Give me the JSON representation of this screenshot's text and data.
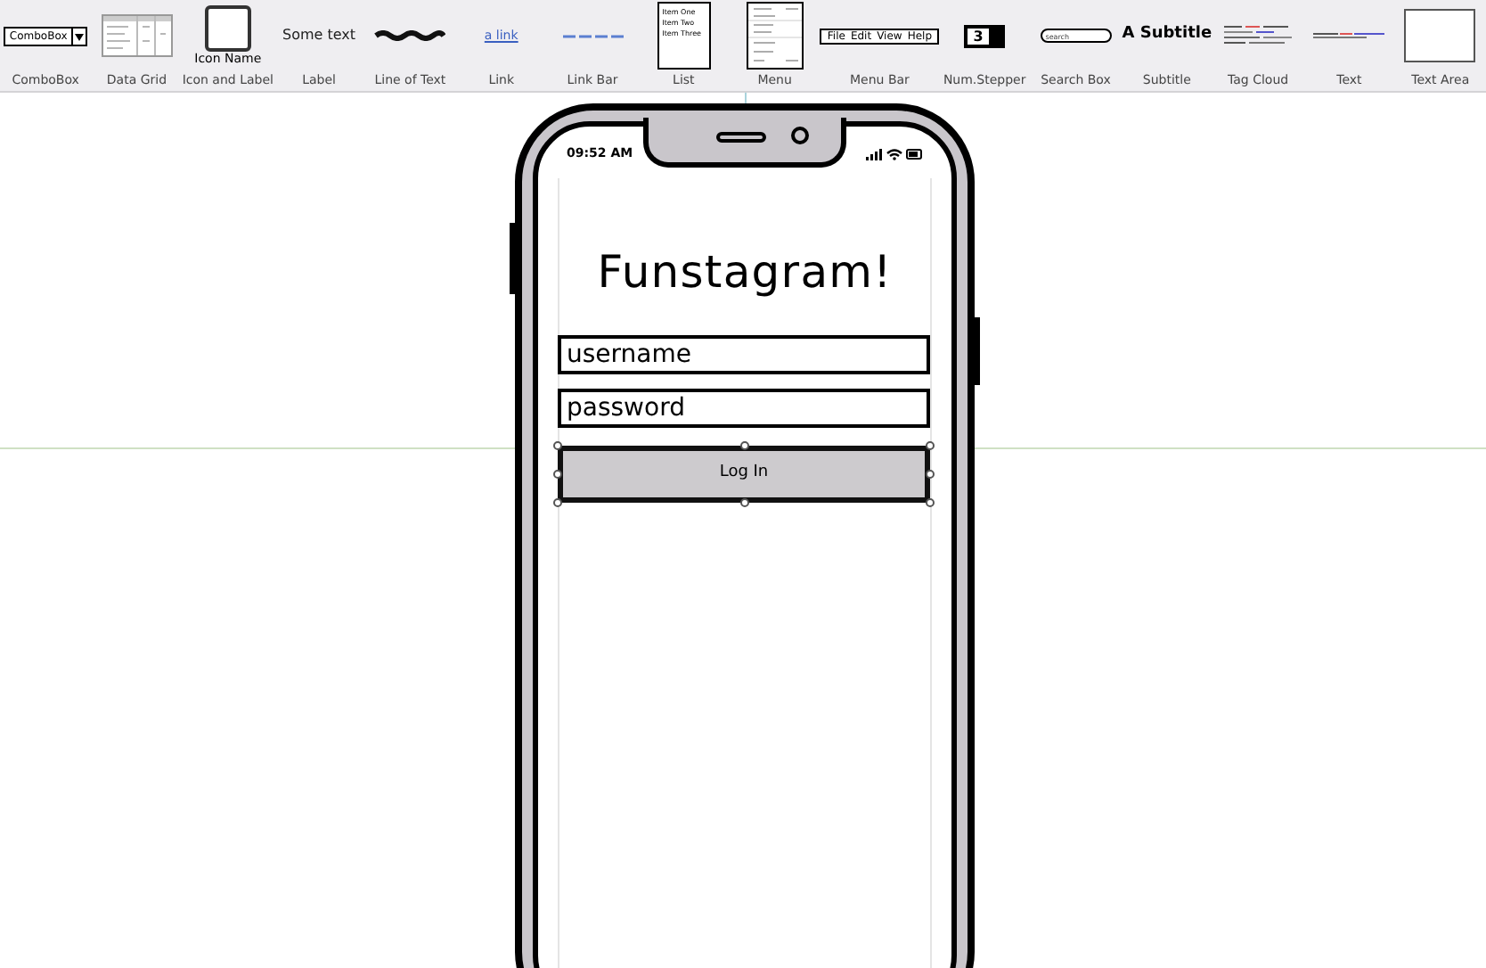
{
  "toolbar": {
    "items": [
      {
        "kind": "combobox",
        "preview": [
          "ComboBox"
        ],
        "label": "ComboBox"
      },
      {
        "kind": "grid",
        "label": "Data Grid"
      },
      {
        "kind": "icon",
        "preview": [
          "Icon Name"
        ],
        "label": "Icon and Label"
      },
      {
        "kind": "label",
        "preview": [
          "Some text"
        ],
        "label": "Label"
      },
      {
        "kind": "line",
        "label": "Line of Text"
      },
      {
        "kind": "link",
        "preview": [
          "a link"
        ],
        "label": "Link"
      },
      {
        "kind": "linkbar",
        "label": "Link Bar"
      },
      {
        "kind": "list",
        "preview": [
          "Item One",
          "Item Two",
          "Item Three"
        ],
        "label": "List"
      },
      {
        "kind": "menu",
        "label": "Menu"
      },
      {
        "kind": "menubar",
        "preview": [
          "File",
          "Edit",
          "View",
          "Help"
        ],
        "label": "Menu Bar"
      },
      {
        "kind": "stepper",
        "preview": [
          "3"
        ],
        "label": "Num.Stepper"
      },
      {
        "kind": "search",
        "preview": [
          "search"
        ],
        "label": "Search Box"
      },
      {
        "kind": "subtitle",
        "preview": [
          "A Subtitle"
        ],
        "label": "Subtitle"
      },
      {
        "kind": "tagcloud",
        "label": "Tag Cloud"
      },
      {
        "kind": "text",
        "label": "Text"
      },
      {
        "kind": "textarea",
        "label": "Text Area"
      }
    ]
  },
  "phone": {
    "status_time": "09:52 AM",
    "title": "Funstagram!",
    "fields": [
      {
        "placeholder": "username"
      },
      {
        "placeholder": "password"
      }
    ],
    "button": {
      "label": "Log In",
      "selected": true
    }
  }
}
